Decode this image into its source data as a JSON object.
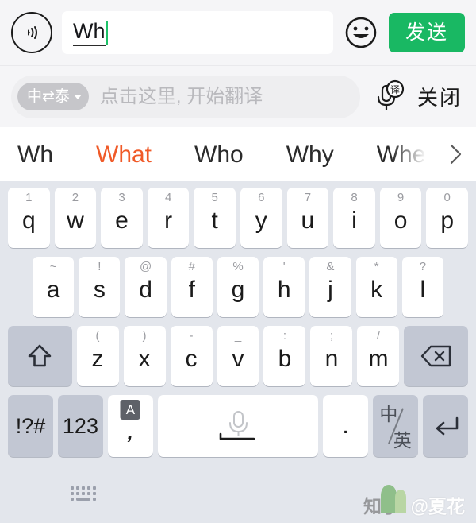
{
  "input_bar": {
    "voice_icon": "voice-wave-icon",
    "text_value": "Wh",
    "emoji_icon": "smiley-face-icon",
    "send_label": "发送",
    "send_color": "#19b863"
  },
  "translate_bar": {
    "language_pair": "中⇄泰",
    "placeholder": "点击这里, 开始翻译",
    "mic_icon": "mic-translate-icon",
    "close_label": "关闭"
  },
  "suggestions": {
    "items": [
      {
        "label": "Wh",
        "active": false
      },
      {
        "label": "What",
        "active": true
      },
      {
        "label": "Who",
        "active": false
      },
      {
        "label": "Why",
        "active": false
      },
      {
        "label": "Where",
        "active": false
      }
    ],
    "active_color": "#f05a28",
    "more_icon": "chevron-right-icon"
  },
  "keyboard": {
    "row1": [
      {
        "main": "q",
        "hint": "1"
      },
      {
        "main": "w",
        "hint": "2"
      },
      {
        "main": "e",
        "hint": "3"
      },
      {
        "main": "r",
        "hint": "4"
      },
      {
        "main": "t",
        "hint": "5"
      },
      {
        "main": "y",
        "hint": "6"
      },
      {
        "main": "u",
        "hint": "7"
      },
      {
        "main": "i",
        "hint": "8"
      },
      {
        "main": "o",
        "hint": "9"
      },
      {
        "main": "p",
        "hint": "0"
      }
    ],
    "row2": [
      {
        "main": "a",
        "hint": "~"
      },
      {
        "main": "s",
        "hint": "!"
      },
      {
        "main": "d",
        "hint": "@"
      },
      {
        "main": "f",
        "hint": "#"
      },
      {
        "main": "g",
        "hint": "%"
      },
      {
        "main": "h",
        "hint": "'"
      },
      {
        "main": "j",
        "hint": "&"
      },
      {
        "main": "k",
        "hint": "*"
      },
      {
        "main": "l",
        "hint": "?"
      }
    ],
    "row3": [
      {
        "main": "z",
        "hint": "("
      },
      {
        "main": "x",
        "hint": ")"
      },
      {
        "main": "c",
        "hint": "-"
      },
      {
        "main": "v",
        "hint": "_"
      },
      {
        "main": "b",
        "hint": ":"
      },
      {
        "main": "n",
        "hint": ";"
      },
      {
        "main": "m",
        "hint": "/"
      }
    ],
    "shift_icon": "shift-arrow-icon",
    "backspace_icon": "backspace-icon",
    "symbols_label": "!?#",
    "numbers_label": "123",
    "caps_badge": "A",
    "comma_label": ",",
    "space_icon": "mic-space-icon",
    "period_label": ".",
    "lang_toggle_cn": "中",
    "lang_toggle_en": "英",
    "enter_icon": "enter-return-icon"
  },
  "bottom_bar": {
    "dismiss_icon": "keyboard-dismiss-icon",
    "watermark_brand": "知乎",
    "watermark_user": "@夏花"
  }
}
